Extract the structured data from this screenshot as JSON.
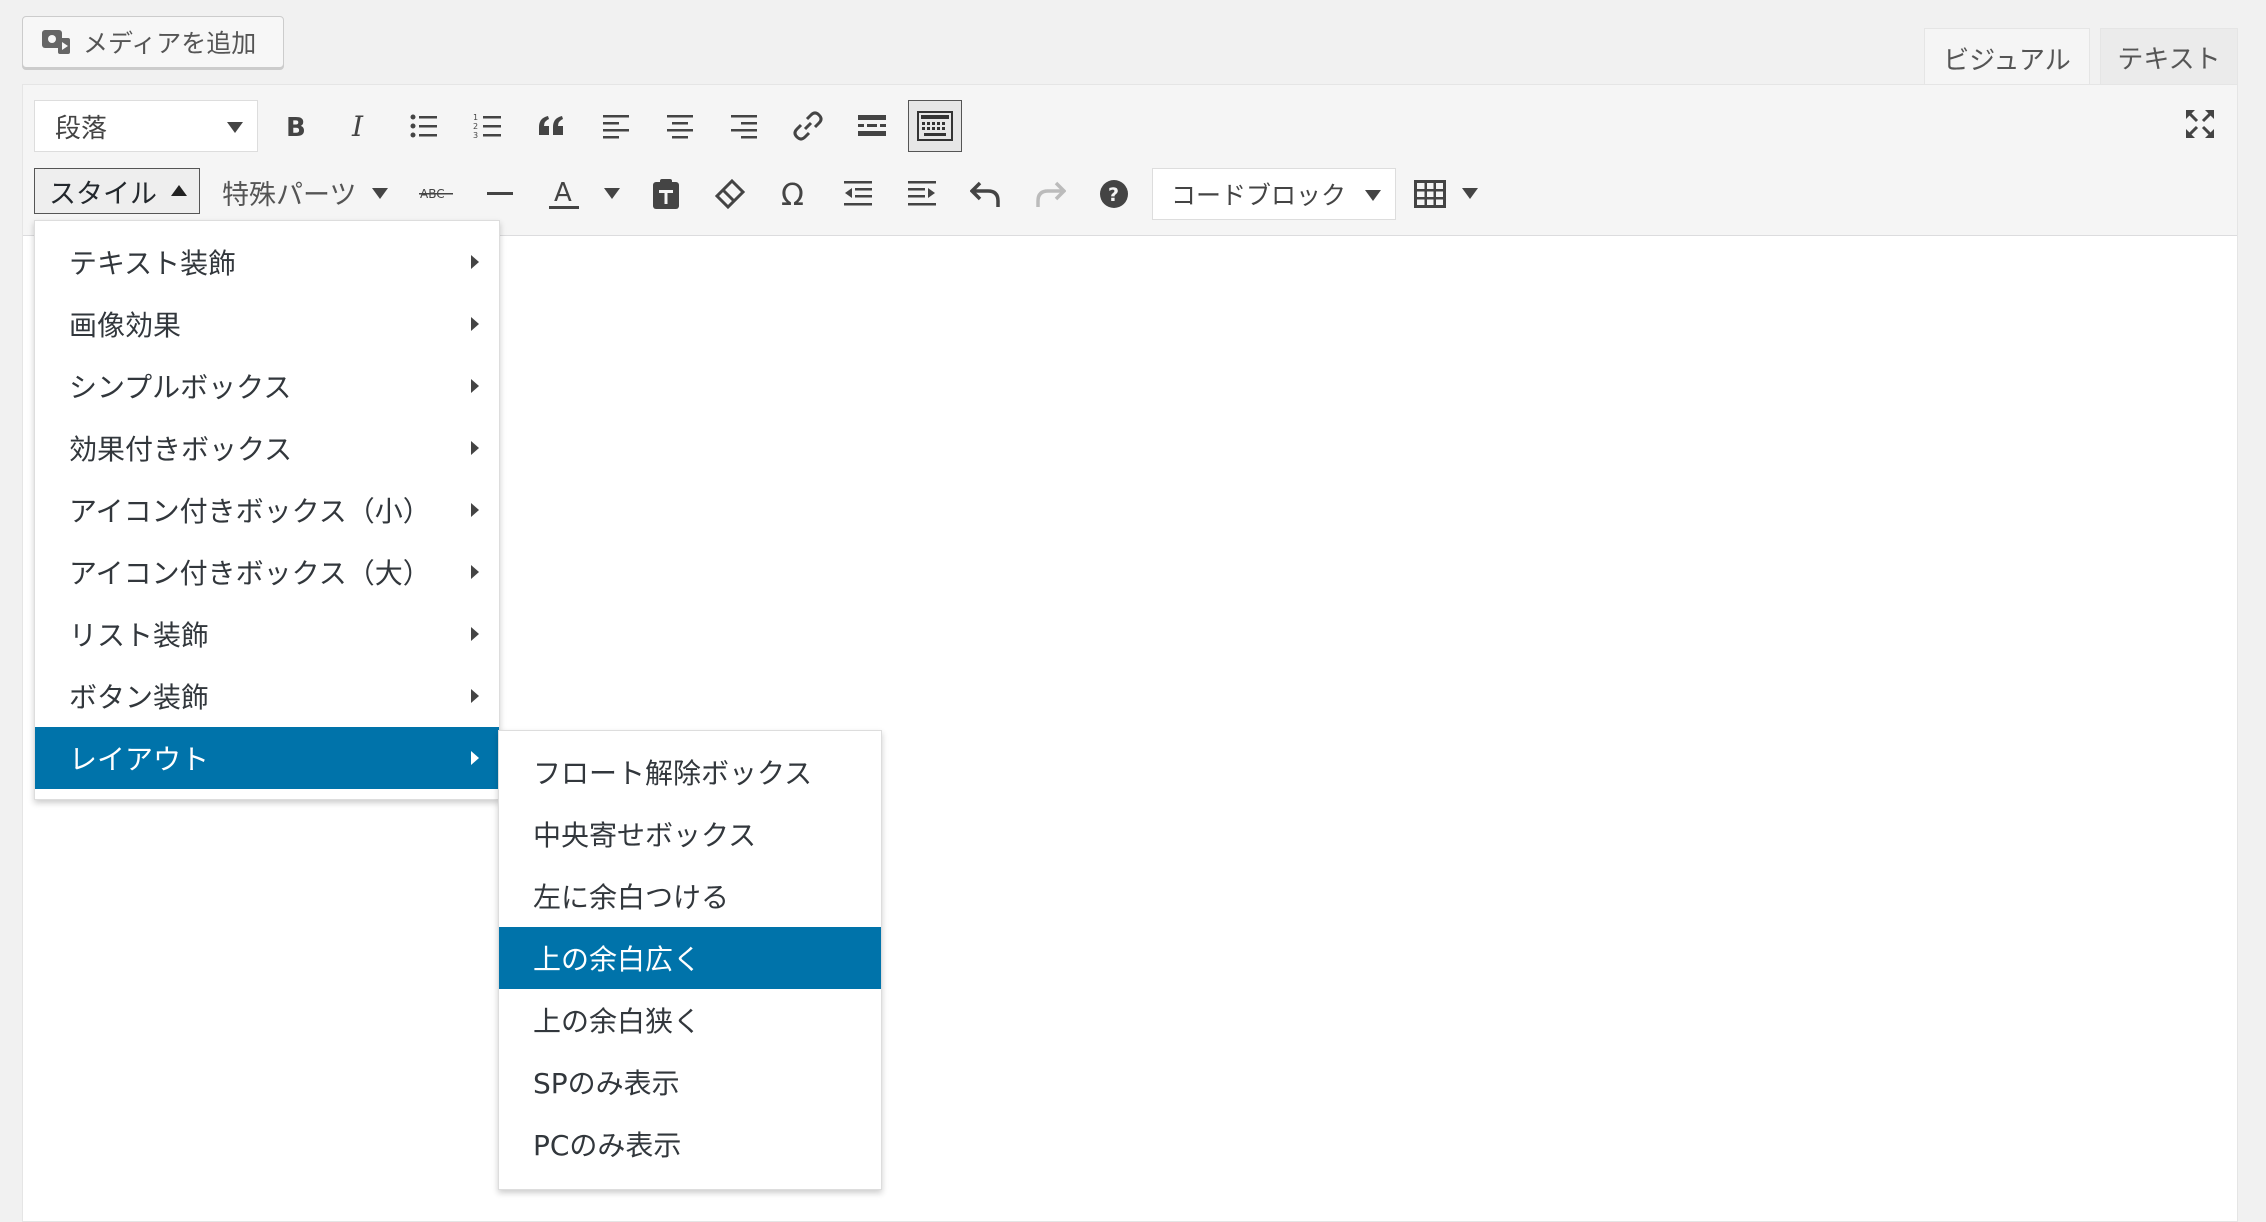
{
  "media_button": {
    "label": "メディアを追加",
    "icon": "media-icon"
  },
  "tabs": [
    {
      "label": "ビジュアル",
      "active": true
    },
    {
      "label": "テキスト",
      "active": false
    }
  ],
  "toolbar": {
    "format_select": "段落",
    "style_button": "スタイル",
    "special_parts": "特殊パーツ",
    "code_block_select": "コードブロック",
    "row1_icons": [
      "bold-icon",
      "italic-icon",
      "bullet-list-icon",
      "numbered-list-icon",
      "blockquote-icon",
      "align-left-icon",
      "align-center-icon",
      "align-right-icon",
      "link-icon",
      "read-more-icon",
      "toolbar-toggle-icon"
    ],
    "row2_icons": [
      "strikethrough-icon",
      "horizontal-rule-icon",
      "text-color-icon",
      "paste-as-text-icon",
      "clear-formatting-icon",
      "special-character-icon",
      "outdent-icon",
      "indent-icon",
      "undo-icon",
      "redo-icon",
      "help-icon",
      "table-icon"
    ],
    "fullscreen_icon": "fullscreen-icon"
  },
  "style_menu": {
    "items": [
      {
        "label": "テキスト装飾",
        "active": false
      },
      {
        "label": "画像効果",
        "active": false
      },
      {
        "label": "シンプルボックス",
        "active": false
      },
      {
        "label": "効果付きボックス",
        "active": false
      },
      {
        "label": "アイコン付きボックス（小）",
        "active": false
      },
      {
        "label": "アイコン付きボックス（大）",
        "active": false
      },
      {
        "label": "リスト装飾",
        "active": false
      },
      {
        "label": "ボタン装飾",
        "active": false
      },
      {
        "label": "レイアウト",
        "active": true
      }
    ]
  },
  "layout_submenu": {
    "items": [
      {
        "label": "フロート解除ボックス",
        "active": false
      },
      {
        "label": "中央寄せボックス",
        "active": false
      },
      {
        "label": "左に余白つける",
        "active": false
      },
      {
        "label": "上の余白広く",
        "active": true
      },
      {
        "label": "上の余白狭く",
        "active": false
      },
      {
        "label": "SPのみ表示",
        "active": false
      },
      {
        "label": "PCのみ表示",
        "active": false
      }
    ]
  },
  "colors": {
    "accent": "#0073aa",
    "toolbar_bg": "#f5f5f5",
    "page_bg": "#f1f1f1"
  }
}
